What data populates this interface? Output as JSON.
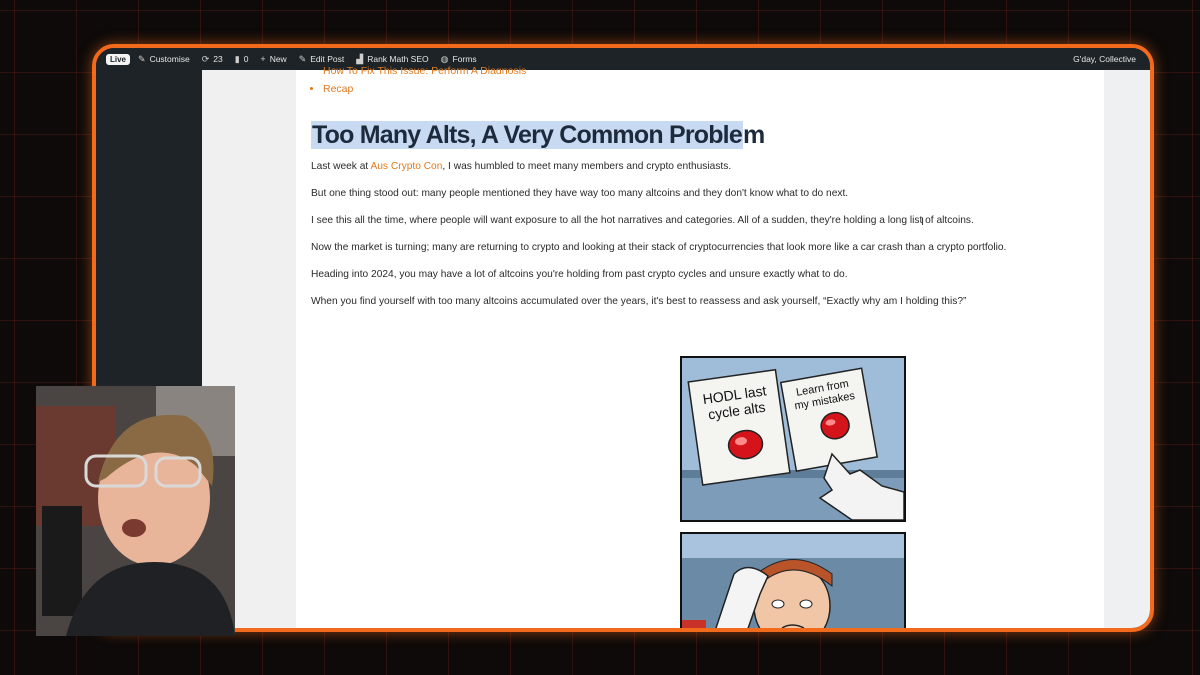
{
  "admin_bar": {
    "live": "Live",
    "customise": "Customise",
    "updates": "23",
    "comments": "0",
    "new": "New",
    "edit_post": "Edit Post",
    "rank_math": "Rank Math SEO",
    "forms": "Forms",
    "greeting": "G'day, Collective"
  },
  "toc": [
    "How To Fix This Issue: Perform A Diagnosis",
    "Recap"
  ],
  "article": {
    "heading_highlighted": "Too Many Alts, A Very Common Proble",
    "heading_rest": "m",
    "p1_before": "Last week at ",
    "p1_link": "Aus Crypto Con",
    "p1_after": ", I was humbled to meet many members and crypto enthusiasts.",
    "p2": "But one thing stood out: many people mentioned they have way too many altcoins and they don't know what to do next.",
    "p3": "I see this all the time, where people will want exposure to all the hot narratives and categories. All of a sudden, they're holding a long list of altcoins.",
    "p4": "Now the market is turning; many are returning to crypto and looking at their stack of cryptocurrencies that look more like a car crash than a crypto portfolio.",
    "p5": "Heading into 2024, you may have a lot of altcoins you're holding from past crypto cycles and unsure exactly what to do.",
    "p6": "When you find yourself with too many altcoins accumulated over the years, it's best to reassess and ask yourself, “Exactly why am I holding this?”"
  },
  "meme": {
    "button_left_label_1": "HODL last",
    "button_left_label_2": "cycle alts",
    "button_right_label_1": "Learn from",
    "button_right_label_2": "my mistakes"
  },
  "colors": {
    "frame": "#f26a1b",
    "link": "#e07a1f",
    "highlight": "#c8d9f2"
  }
}
